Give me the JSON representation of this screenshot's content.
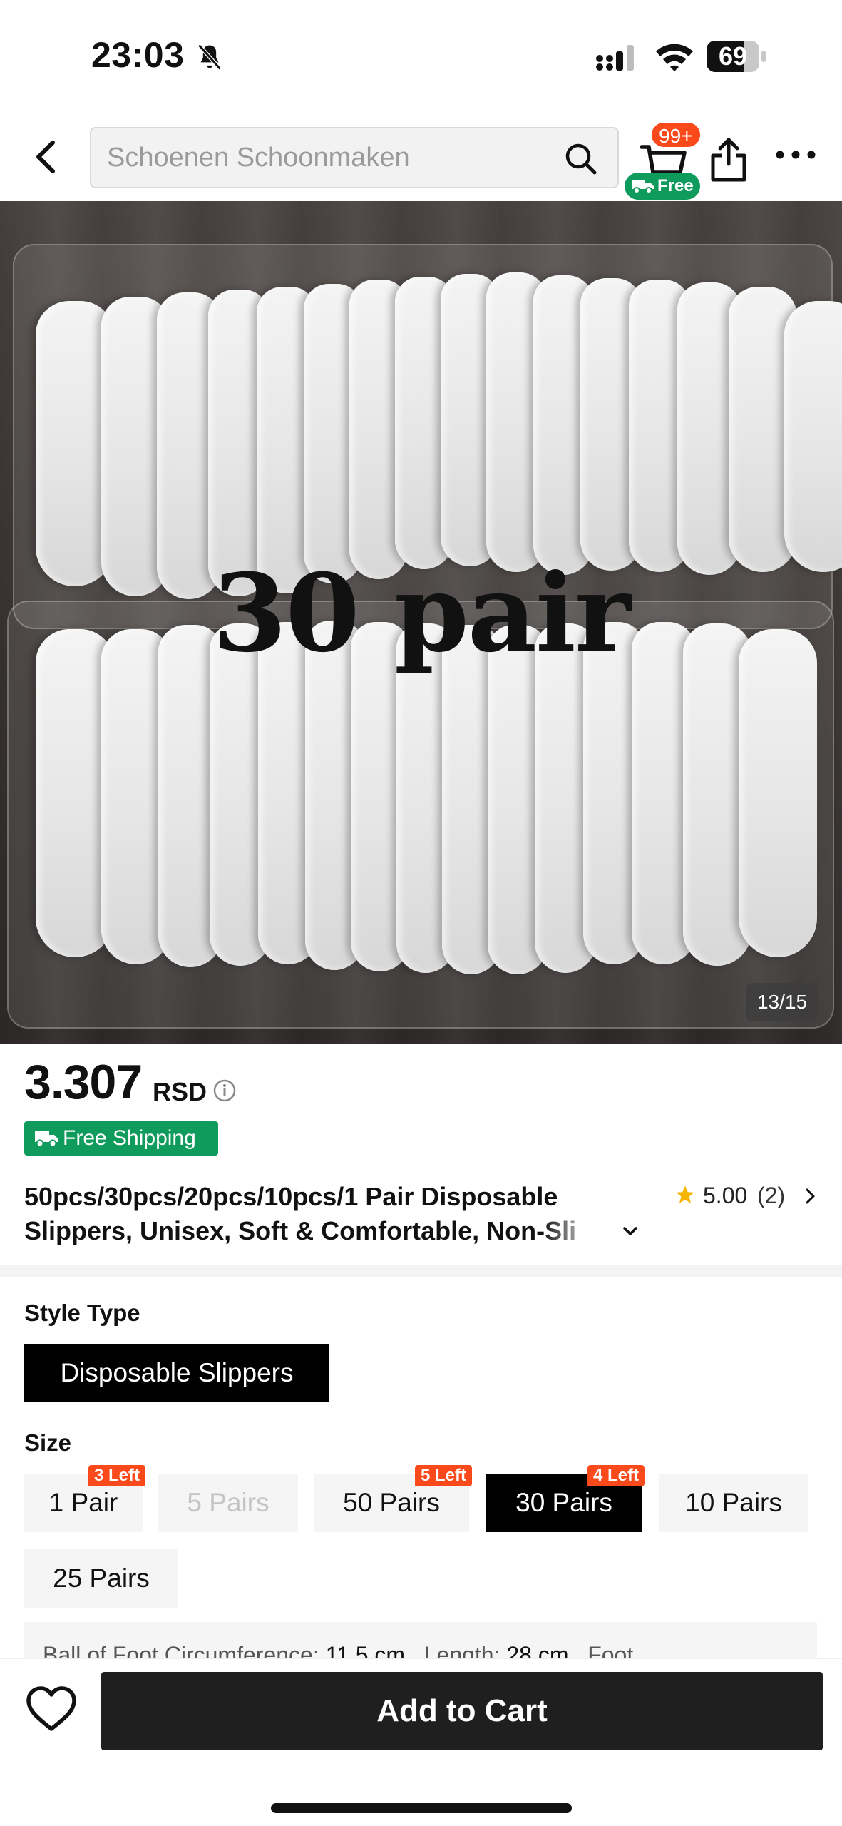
{
  "status_bar": {
    "time": "23:03",
    "battery": "69"
  },
  "nav": {
    "search_placeholder": "Schoenen Schoonmaken",
    "cart_badge": "99+",
    "free_badge": "Free"
  },
  "image": {
    "overlay_text": "30 pair",
    "counter": "13/15"
  },
  "product": {
    "price": "3.307",
    "currency": "RSD",
    "free_shipping": "Free Shipping",
    "title_line1": "50pcs/30pcs/20pcs/10pcs/1 Pair Disposable",
    "title_line2": "Slippers, Unisex, Soft & Comfortable, Non-Sli",
    "rating": "5.00",
    "rating_count": "(2)"
  },
  "style_type": {
    "label": "Style Type",
    "options": [
      "Disposable Slippers"
    ],
    "selected": "Disposable Slippers"
  },
  "size": {
    "label": "Size",
    "options": [
      {
        "label": "1 Pair",
        "stock": "3 Left",
        "state": "available"
      },
      {
        "label": "5 Pairs",
        "stock": "",
        "state": "disabled"
      },
      {
        "label": "50 Pairs",
        "stock": "5 Left",
        "state": "available"
      },
      {
        "label": "30 Pairs",
        "stock": "4 Left",
        "state": "selected"
      },
      {
        "label": "10 Pairs",
        "stock": "",
        "state": "available"
      },
      {
        "label": "25 Pairs",
        "stock": "",
        "state": "available"
      }
    ],
    "info": {
      "ball_label": "Ball  of  Foot Circumference:",
      "ball_value": "11.5 cm",
      "length_label": "Length:",
      "length_value": "28 cm",
      "foot_label": "Foot"
    }
  },
  "bottom": {
    "add_to_cart": "Add to Cart"
  },
  "colors": {
    "accent_green": "#0f9b5c",
    "badge_red": "#fa4a1c",
    "selected_black": "#000000"
  }
}
